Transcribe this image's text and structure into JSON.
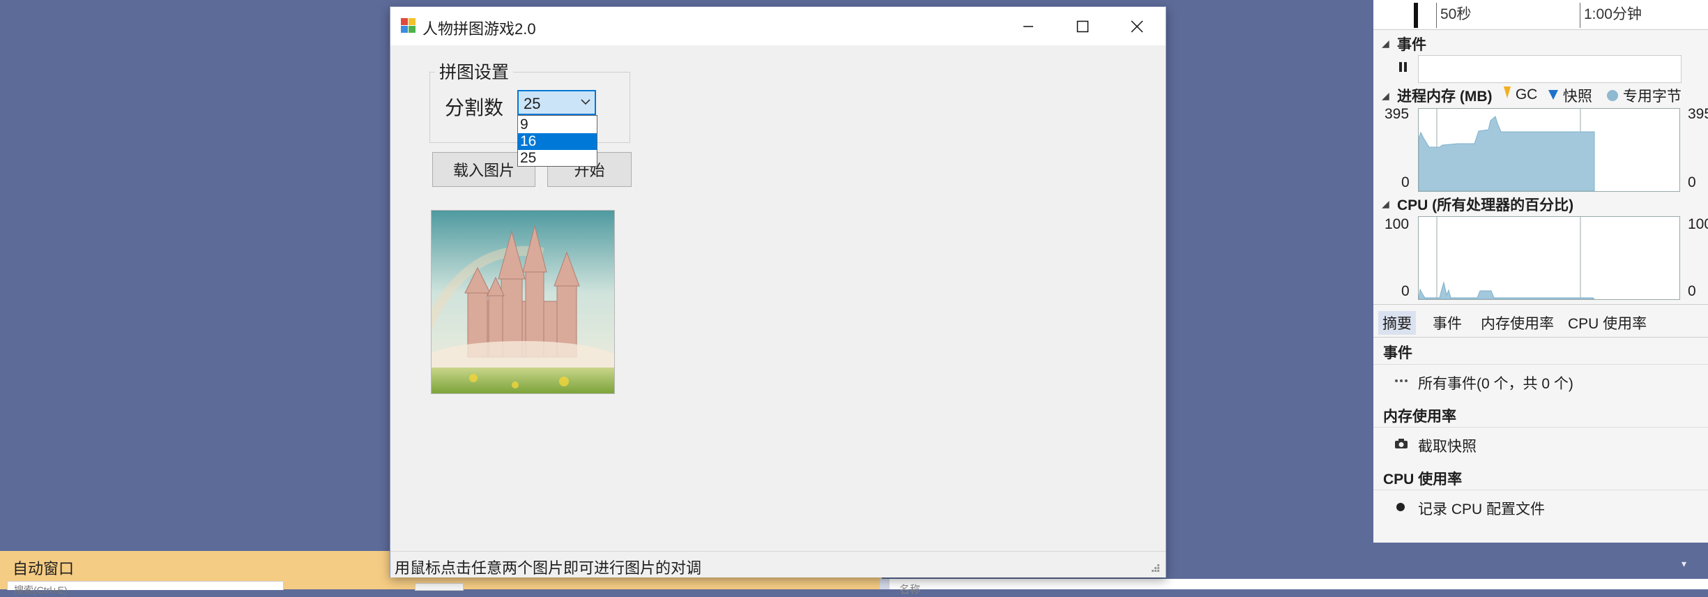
{
  "window": {
    "title": "人物拼图游戏2.0",
    "group_title": "拼图设置",
    "split_label": "分割数",
    "combo_value": "25",
    "dropdown_options": [
      "9",
      "16",
      "25"
    ],
    "dropdown_highlighted": "16",
    "load_button": "载入图片",
    "start_button": "开始",
    "status_text": "用鼠标点击任意两个图片即可进行图片的对调"
  },
  "ide": {
    "autos_title": "自动窗口",
    "autos_search_placeholder": "搜索(Ctrl+E)",
    "name_header": "名称"
  },
  "diagnostics": {
    "timeline_50s": "50秒",
    "timeline_1min": "1:00分钟",
    "events_heading": "事件",
    "memory_heading": "进程内存 (MB)",
    "legend_gc": "GC",
    "legend_snapshot": "快照",
    "legend_private": "专用字节",
    "memory_ymax": "395",
    "memory_ymin": "0",
    "cpu_heading": "CPU (所有处理器的百分比)",
    "cpu_ymax": "100",
    "cpu_ymin": "0",
    "tabs": [
      "摘要",
      "事件",
      "内存使用率",
      "CPU 使用率"
    ],
    "summary": {
      "events_h": "事件",
      "events_row": "所有事件(0 个，共 0 个)",
      "memory_h": "内存使用率",
      "memory_row": "截取快照",
      "cpu_h": "CPU 使用率",
      "cpu_row": "记录 CPU 配置文件"
    },
    "colors": {
      "area": "#a3c8dc",
      "gc": "#f2b01e",
      "snapshot": "#1e73c8",
      "private": "#8fb9d0"
    }
  }
}
